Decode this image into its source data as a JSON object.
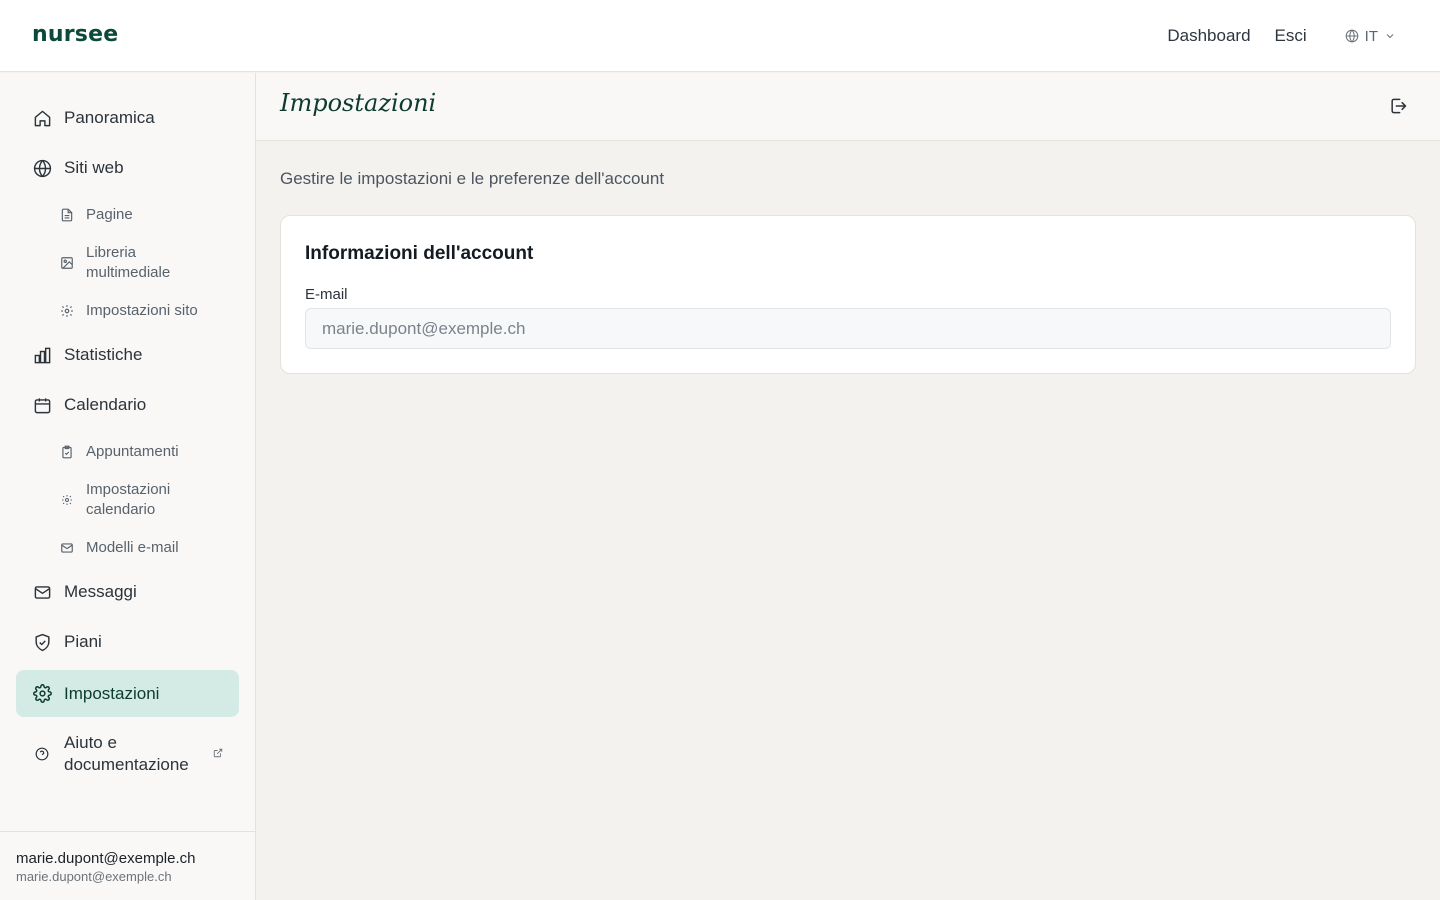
{
  "app": {
    "logo": "nursee"
  },
  "topnav": {
    "dashboard": "Dashboard",
    "logout": "Esci",
    "language": "IT"
  },
  "sidebar": {
    "items": [
      {
        "label": "Panoramica",
        "icon": "home-icon"
      },
      {
        "label": "Siti web",
        "icon": "globe-icon",
        "children": [
          {
            "label": "Pagine",
            "icon": "file-icon"
          },
          {
            "label": "Libreria multimediale",
            "icon": "image-icon"
          },
          {
            "label": "Impostazioni sito",
            "icon": "gear-icon"
          }
        ]
      },
      {
        "label": "Statistiche",
        "icon": "bar-chart-icon"
      },
      {
        "label": "Calendario",
        "icon": "calendar-icon",
        "children": [
          {
            "label": "Appuntamenti",
            "icon": "clipboard-check-icon"
          },
          {
            "label": "Impostazioni calendario",
            "icon": "gear-icon"
          },
          {
            "label": "Modelli e-mail",
            "icon": "mail-icon"
          }
        ]
      },
      {
        "label": "Messaggi",
        "icon": "mail-icon"
      },
      {
        "label": "Piani",
        "icon": "shield-check-icon"
      },
      {
        "label": "Impostazioni",
        "icon": "gear-icon",
        "active": true
      },
      {
        "label": "Aiuto e documentazione",
        "icon": "help-circle-icon",
        "external": true
      }
    ],
    "user": {
      "name": "marie.dupont@exemple.ch",
      "email": "marie.dupont@exemple.ch"
    }
  },
  "header": {
    "title": "Impostazioni"
  },
  "main": {
    "subtitle": "Gestire le impostazioni e le preferenze dell'account",
    "account_card": {
      "title": "Informazioni dell'account",
      "email_label": "E-mail",
      "email_value": "marie.dupont@exemple.ch"
    }
  },
  "colors": {
    "brand": "#0b4a3a",
    "active_bg": "#d3ebe4",
    "page_bg": "#f3f2ef"
  }
}
